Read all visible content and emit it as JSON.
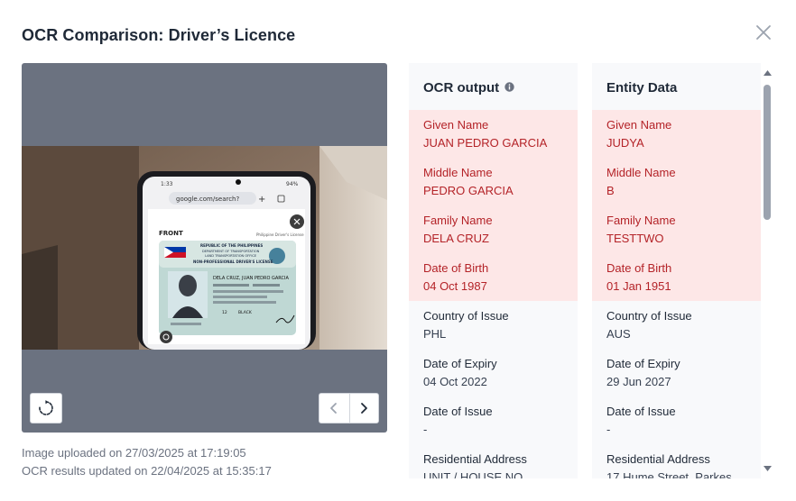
{
  "dialog": {
    "title": "OCR Comparison: Driver’s Licence"
  },
  "viewer": {
    "uploaded": "Image uploaded on 27/03/2025 at 17:19:05",
    "ocr_updated": "OCR results updated on 22/04/2025 at 15:35:17"
  },
  "photo": {
    "status_time": "1:33",
    "battery": "94%",
    "url": "google.com/search?",
    "front_label": "FRONT",
    "side_label": "Philippine Driver's License",
    "card_title_1": "REPUBLIC OF THE PHILIPPINES",
    "card_title_2": "DEPARTMENT OF TRANSPORTATION",
    "card_title_3": "LAND TRANSPORTATION OFFICE",
    "card_title_4": "NON-PROFESSIONAL DRIVER'S LICENSE",
    "card_name": "DELA CRUZ, JUAN PEDRO GARCIA",
    "card_value_1": "12",
    "card_value_2": "BLACK"
  },
  "ocr": {
    "heading": "OCR output",
    "fields": [
      {
        "label": "Given Name",
        "value": "JUAN PEDRO GARCIA"
      },
      {
        "label": "Middle Name",
        "value": "PEDRO GARCIA"
      },
      {
        "label": "Family Name",
        "value": "DELA CRUZ"
      },
      {
        "label": "Date of Birth",
        "value": "04 Oct 1987"
      },
      {
        "label": "Country of Issue",
        "value": "PHL"
      },
      {
        "label": "Date of Expiry",
        "value": "04 Oct 2022"
      },
      {
        "label": "Date of Issue",
        "value": "-"
      },
      {
        "label": "Residential Address",
        "value": "UNIT / HOUSE NO"
      }
    ]
  },
  "entity": {
    "heading": "Entity Data",
    "fields": [
      {
        "label": "Given Name",
        "value": "JUDYA"
      },
      {
        "label": "Middle Name",
        "value": "B"
      },
      {
        "label": "Family Name",
        "value": "TESTTWO"
      },
      {
        "label": "Date of Birth",
        "value": "01 Jan 1951"
      },
      {
        "label": "Country of Issue",
        "value": "AUS"
      },
      {
        "label": "Date of Expiry",
        "value": "29 Jun 2027"
      },
      {
        "label": "Date of Issue",
        "value": "-"
      },
      {
        "label": "Residential Address",
        "value": "17 Hume Street, Parkes"
      }
    ]
  },
  "colors": {
    "mismatch_bg": "#fde7e7",
    "mismatch_text": "#b42328",
    "panel_bg": "#f8f9fb",
    "viewer_bg": "#6b7280"
  },
  "icons": {
    "close": "close-icon",
    "info": "info-icon",
    "rotate": "rotate-icon",
    "prev": "chevron-left-icon",
    "next": "chevron-right-icon"
  }
}
